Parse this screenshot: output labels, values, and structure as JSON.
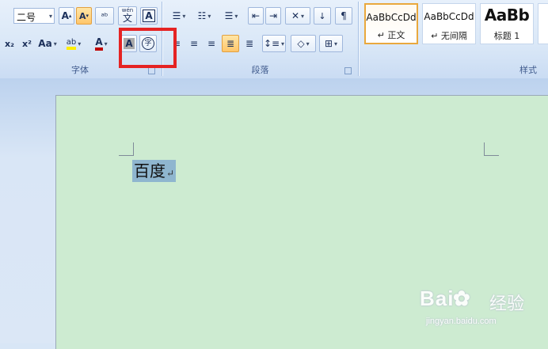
{
  "ribbon": {
    "font_group": {
      "label": "字体",
      "font_size": "二号",
      "grow_font": "A",
      "shrink_font": "A",
      "clear_format": "ᵃᵇ",
      "phonetic_guide": "wén",
      "phonetic_guide_char": "文",
      "char_border": "A",
      "subscript": "x₂",
      "superscript": "x²",
      "change_case": "Aa",
      "highlight": "ab",
      "font_color": "A",
      "char_shading": "A",
      "enclose_char": "字"
    },
    "paragraph_group": {
      "label": "段落"
    },
    "styles_group": {
      "label": "样式",
      "styles": [
        {
          "sample": "AaBbCcDd",
          "name": "↵ 正文"
        },
        {
          "sample": "AaBbCcDd",
          "name": "↵ 无间隔"
        },
        {
          "sample": "AaBb",
          "name": "标题 1"
        }
      ]
    }
  },
  "document": {
    "text": "百度",
    "paragraph_mark": "↵"
  },
  "watermark": {
    "logo": "Bai  ",
    "logo_cn": "经验",
    "url": "jingyan.baidu.com"
  },
  "colors": {
    "page_background": "#cdebd1",
    "selection": "#8fb6cf",
    "annotation": "#e52323",
    "ribbon": "#dbe7f7"
  }
}
